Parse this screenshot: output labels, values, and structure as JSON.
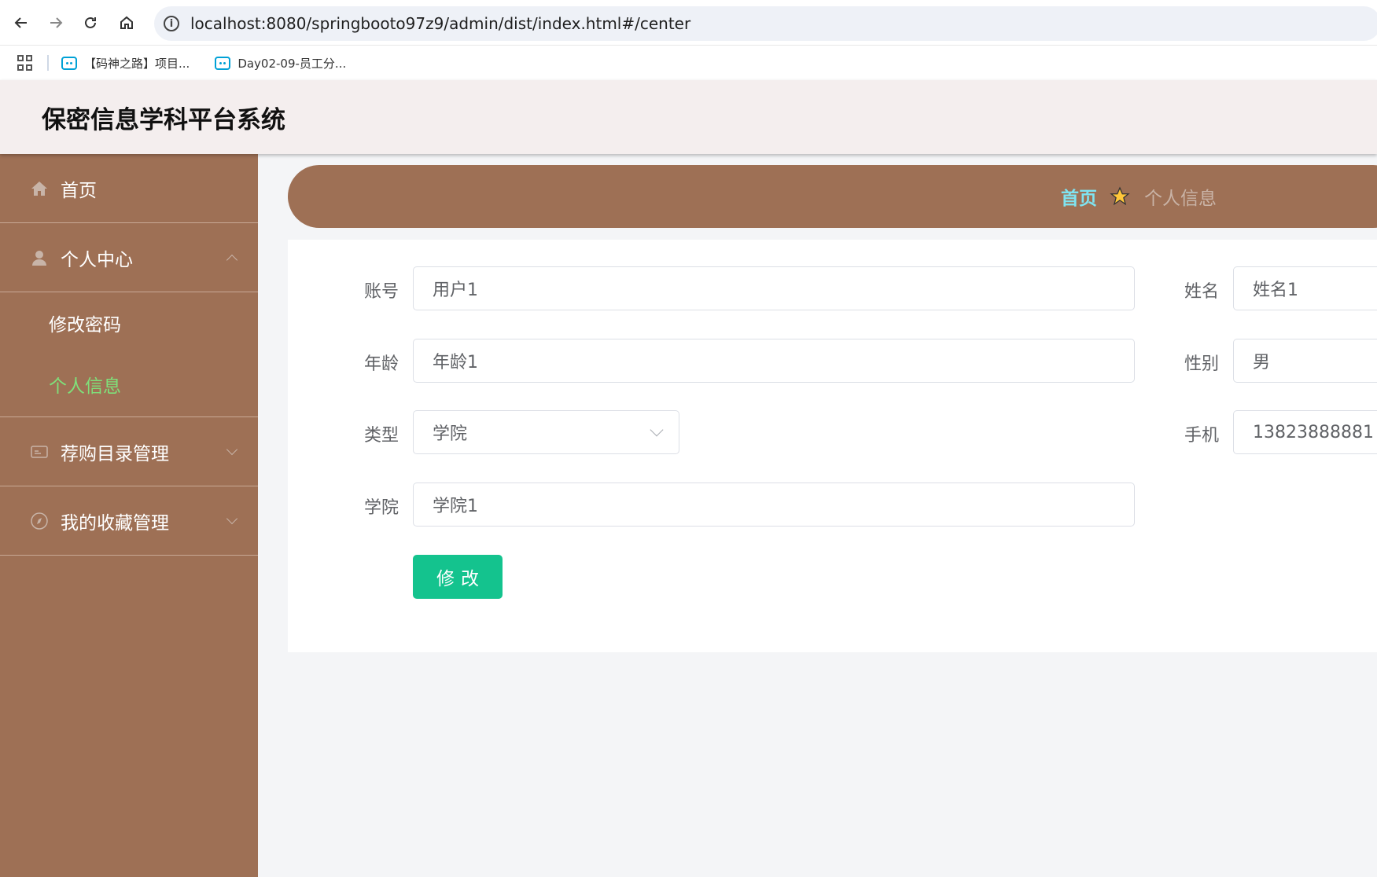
{
  "browser": {
    "url": "localhost:8080/springbooto97z9/admin/dist/index.html#/center",
    "bookmarks": [
      "【码神之路】项目...",
      "Day02-09-员工分..."
    ]
  },
  "header": {
    "title": "保密信息学科平台系统"
  },
  "sidebar": {
    "items": [
      {
        "label": "首页",
        "icon": "home-icon"
      },
      {
        "label": "个人中心",
        "icon": "user-icon",
        "expanded": true,
        "children": [
          "修改密码",
          "个人信息"
        ]
      },
      {
        "label": "荐购目录管理",
        "icon": "card-icon"
      },
      {
        "label": "我的收藏管理",
        "icon": "compass-icon"
      }
    ],
    "active_child": "个人信息"
  },
  "breadcrumb": {
    "home": "首页",
    "current": "个人信息"
  },
  "form": {
    "account_label": "账号",
    "account_value": "用户1",
    "name_label": "姓名",
    "name_value": "姓名1",
    "age_label": "年龄",
    "age_value": "年龄1",
    "gender_label": "性别",
    "gender_value": "男",
    "type_label": "类型",
    "type_value": "学院",
    "phone_label": "手机",
    "phone_value": "13823888881",
    "college_label": "学院",
    "college_value": "学院1",
    "submit_label": "修改"
  },
  "colors": {
    "sidebar": "#9e7055",
    "header": "#f4eeee",
    "active": "#7fe07a",
    "breadcrumb_home": "#7fe3f0",
    "submit": "#14c38e"
  }
}
